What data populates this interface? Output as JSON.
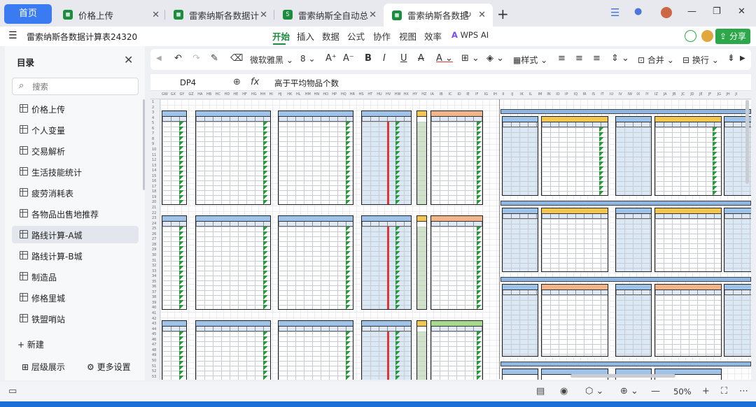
{
  "tabs": {
    "home": "首页",
    "items": [
      {
        "label": "价格上传",
        "icon": "sheet-icon"
      },
      {
        "label": "雷索纳斯各数据计",
        "icon": "sheet-icon"
      },
      {
        "label": "雷索纳斯全自动总",
        "icon": "s-icon"
      },
      {
        "label": "雷索纳斯各数据",
        "icon": "sheet-icon"
      }
    ],
    "new_tab": "+"
  },
  "menu": {
    "doc_name": "雷索纳斯各数据计算表24320",
    "items": [
      "开始",
      "插入",
      "数据",
      "公式",
      "协作",
      "视图",
      "效率"
    ],
    "active": "开始",
    "ai_label": "WPS AI",
    "share": "分享"
  },
  "sidebar": {
    "title": "目录",
    "search_placeholder": "搜索",
    "items": [
      "价格上传",
      "个人变量",
      "交易解析",
      "生活技能统计",
      "疲劳消耗表",
      "各物品出售地推荐",
      "路线计算-A城",
      "路线计算-B城",
      "制造品",
      "修格里城",
      "铁盟哨站"
    ],
    "selected_index": 6,
    "new_label": "新建",
    "level_label": "层级展示",
    "more_label": "更多设置"
  },
  "toolbar": {
    "font_name": "微软雅黑",
    "font_size": "8",
    "style_label": "样式",
    "merge_label": "合并",
    "wrap_label": "换行"
  },
  "formula_bar": {
    "cell_ref": "DP4",
    "fx": "fx",
    "formula": "高于平均物品个数"
  },
  "grid": {
    "columns": [
      "GW",
      "GX",
      "GY",
      "GZ",
      "HA",
      "HB",
      "HC",
      "HD",
      "HE",
      "HF",
      "HG",
      "HH",
      "HI",
      "HJ",
      "HK",
      "HL",
      "HM",
      "HN",
      "HO",
      "HP",
      "HQ",
      "HR",
      "HS",
      "HT",
      "HU",
      "HV",
      "HW",
      "HX",
      "HY",
      "HZ",
      "IA",
      "IB",
      "IC",
      "ID",
      "IE",
      "IF",
      "IG",
      "IH",
      "II",
      "IJ",
      "IK",
      "IL",
      "IM",
      "IN",
      "IO",
      "IP",
      "IQ",
      "IR",
      "IS",
      "IT",
      "IU",
      "IV",
      "IW",
      "IX",
      "IY",
      "IZ",
      "JA",
      "JB",
      "JC",
      "JD",
      "JE",
      "JF",
      "JG",
      "JH",
      "JI"
    ],
    "rows": [
      "1",
      "2",
      "3",
      "4",
      "5",
      "6",
      "7",
      "8",
      "9",
      "10",
      "11",
      "12",
      "13",
      "14",
      "15",
      "16",
      "17",
      "18",
      "19",
      "20",
      "21",
      "22",
      "23",
      "24",
      "25",
      "26",
      "27",
      "28",
      "29",
      "30",
      "31",
      "32",
      "33",
      "34",
      "35",
      "36",
      "37",
      "38",
      "39",
      "40",
      "41",
      "42",
      "43",
      "44",
      "45",
      "46",
      "47",
      "48",
      "49",
      "50",
      "51",
      "52",
      "53"
    ]
  },
  "status": {
    "zoom": "50%"
  }
}
